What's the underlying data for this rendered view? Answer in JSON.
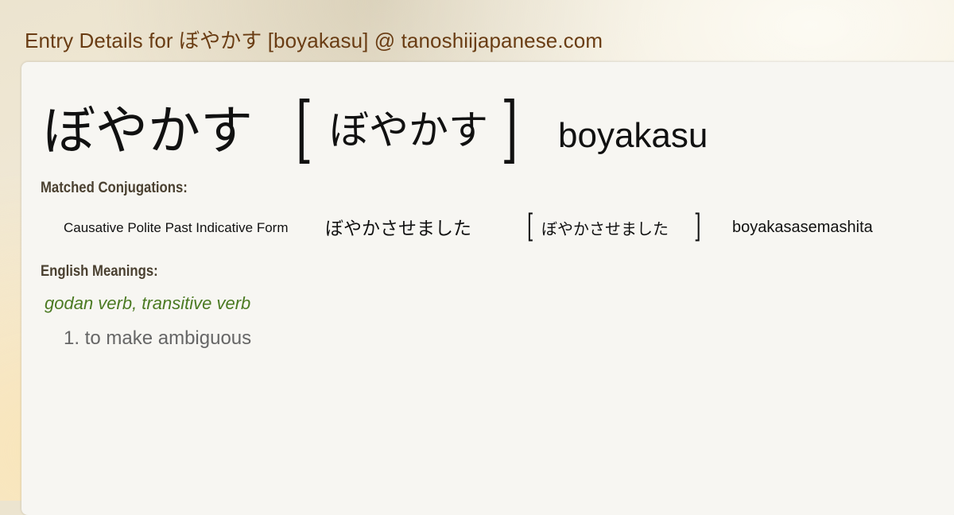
{
  "header": {
    "title_prefix": "Entry Details for ",
    "title_kana": "ぼやかす",
    "title_suffix": " [boyakasu] @ tanoshiijapanese.com"
  },
  "entry": {
    "kana": "ぼやかす",
    "bracket_open": "[",
    "reading": "ぼやかす",
    "bracket_close": "]",
    "romaji": "boyakasu"
  },
  "conjugations": {
    "label": "Matched Conjugations:",
    "items": [
      {
        "form": "Causative Polite Past Indicative Form",
        "kana": "ぼやかさせました",
        "bracket_open": "[",
        "reading": "ぼやかさせました",
        "bracket_close": "]",
        "romaji": "boyakasasemashita"
      }
    ]
  },
  "meanings": {
    "label": "English Meanings:",
    "part_of_speech": "godan verb, transitive verb",
    "items": [
      "1. to make ambiguous"
    ]
  }
}
